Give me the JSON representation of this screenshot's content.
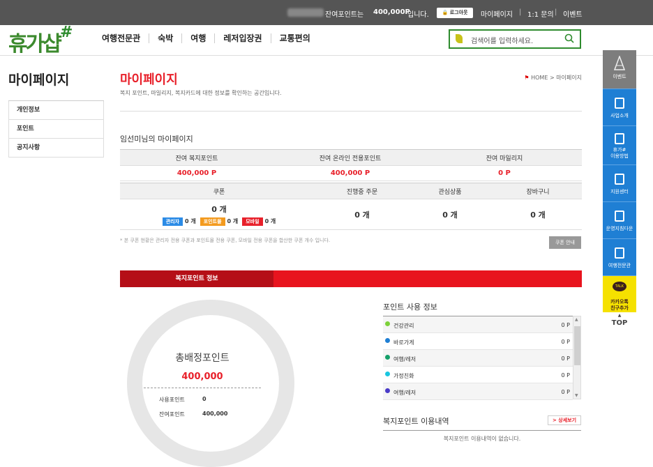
{
  "topbar": {
    "points_text": "잔여포인트는",
    "points_value": "400,000P",
    "points_suffix": "입니다.",
    "logout": "로그아웃",
    "mypage": "마이페이지",
    "inquiry": "1:1 문의",
    "event": "이벤트"
  },
  "header": {
    "logo": "휴가샵",
    "logo_mark": "#",
    "nav": [
      "여행전문관",
      "숙박",
      "여행",
      "레저입장권",
      "교통편의"
    ],
    "search_placeholder": "검색어를 입력하세요."
  },
  "sidebar": {
    "title": "마이페이지",
    "items": [
      {
        "label": "개인정보"
      },
      {
        "label": "포인트"
      },
      {
        "label": "공지사항"
      }
    ]
  },
  "main": {
    "title": "마이페이지",
    "description": "복지 포인트, 마일리지, 복지카드에 대한 정보를 확인하는 공간입니다.",
    "breadcrumb_home": "HOME",
    "breadcrumb_sep": ">",
    "breadcrumb_current": "마이페이지",
    "user_title": "임선미님의 마이페이지",
    "balances": {
      "headers": [
        "잔여 복지포인트",
        "잔여 온라인 전용포인트",
        "잔여 마일리지"
      ],
      "values": [
        "400,000 P",
        "400,000 P",
        "0 P"
      ]
    },
    "status": {
      "headers": [
        "쿠폰",
        "진행중 주문",
        "관심상품",
        "장바구니"
      ],
      "coupon_total": "0 개",
      "coupon_breakdown": [
        {
          "label": "관리자",
          "count": "0 개",
          "color": "#2b8be6"
        },
        {
          "label": "포인트몰",
          "count": "0 개",
          "color": "#f39a1e"
        },
        {
          "label": "모바일",
          "count": "0 개",
          "color": "#e8202a"
        }
      ],
      "orders": "0 개",
      "wishlist": "0 개",
      "cart": "0 개"
    },
    "note": "* 본 쿠폰 현황은 관리자 전용 쿠폰과 포인트몰 전용 쿠폰, 모바일 전용 쿠폰을 합산한 쿠폰 개수 입니다.",
    "coupon_guide": "쿠폰 안내",
    "welfare_tab": "복지포인트 정보",
    "donut": {
      "label": "총배정포인트",
      "total": "400,000",
      "used_label": "사용포인트",
      "used_value": "0",
      "remaining_label": "잔여포인트",
      "remaining_value": "400,000"
    },
    "point_usage": {
      "title": "포인트 사용 정보",
      "rows": [
        {
          "name": "건강관리",
          "value": "0 P",
          "color": "#7dd13a"
        },
        {
          "name": "바로가게",
          "value": "0 P",
          "color": "#1f7fd4"
        },
        {
          "name": "여행/레저",
          "value": "0 P",
          "color": "#16a06a"
        },
        {
          "name": "가정친화",
          "value": "0 P",
          "color": "#19c6e0"
        },
        {
          "name": "여행/레저",
          "value": "0 P",
          "color": "#4a3bc8"
        }
      ]
    },
    "usage_history": {
      "title": "복지포인트 이용내역",
      "more": "> 상세보기",
      "empty": "복지포인트 이용내역이 없습니다."
    }
  },
  "quick_menu": {
    "items": [
      {
        "label": "이벤트"
      },
      {
        "label": "사업소개"
      },
      {
        "label": "휴가#\n이용방법"
      },
      {
        "label": "지원센터"
      },
      {
        "label": "운영지침다운"
      },
      {
        "label": "여행전문관"
      },
      {
        "label": "카카오톡\n친구추가"
      }
    ],
    "kakao_badge": "TALK",
    "top": "TOP"
  }
}
